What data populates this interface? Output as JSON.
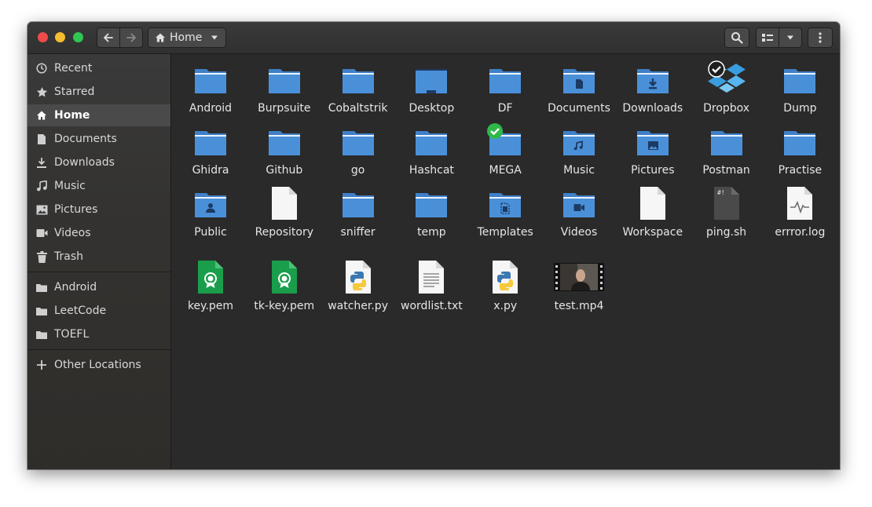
{
  "window": {
    "path_label": "Home"
  },
  "sidebar": {
    "places": [
      {
        "label": "Recent",
        "icon": "clock-icon"
      },
      {
        "label": "Starred",
        "icon": "star-icon"
      },
      {
        "label": "Home",
        "icon": "home-icon",
        "active": true
      },
      {
        "label": "Documents",
        "icon": "document-icon"
      },
      {
        "label": "Downloads",
        "icon": "download-icon"
      },
      {
        "label": "Music",
        "icon": "music-icon"
      },
      {
        "label": "Pictures",
        "icon": "image-icon"
      },
      {
        "label": "Videos",
        "icon": "video-icon"
      },
      {
        "label": "Trash",
        "icon": "trash-icon"
      }
    ],
    "bookmarks": [
      {
        "label": "Android",
        "icon": "folder-icon"
      },
      {
        "label": "LeetCode",
        "icon": "folder-icon"
      },
      {
        "label": "TOEFL",
        "icon": "folder-icon"
      }
    ],
    "other": {
      "label": "Other Locations",
      "icon": "plus-icon"
    }
  },
  "files": [
    {
      "name": "Android",
      "type": "folder"
    },
    {
      "name": "Burpsuite",
      "type": "folder"
    },
    {
      "name": "Cobaltstrik",
      "type": "folder"
    },
    {
      "name": "Desktop",
      "type": "folder-desktop"
    },
    {
      "name": "DF",
      "type": "folder"
    },
    {
      "name": "Documents",
      "type": "folder-documents"
    },
    {
      "name": "Downloads",
      "type": "folder-downloads"
    },
    {
      "name": "Dropbox",
      "type": "dropbox"
    },
    {
      "name": "Dump",
      "type": "folder"
    },
    {
      "name": "Ghidra",
      "type": "folder"
    },
    {
      "name": "Github",
      "type": "folder"
    },
    {
      "name": "go",
      "type": "folder"
    },
    {
      "name": "Hashcat",
      "type": "folder"
    },
    {
      "name": "MEGA",
      "type": "folder-mega"
    },
    {
      "name": "Music",
      "type": "folder-music"
    },
    {
      "name": "Pictures",
      "type": "folder-pictures"
    },
    {
      "name": "Postman",
      "type": "folder"
    },
    {
      "name": "Practise",
      "type": "folder"
    },
    {
      "name": "Public",
      "type": "folder-public"
    },
    {
      "name": "Repository",
      "type": "file-blank"
    },
    {
      "name": "sniffer",
      "type": "folder"
    },
    {
      "name": "temp",
      "type": "folder"
    },
    {
      "name": "Templates",
      "type": "folder-templates"
    },
    {
      "name": "Videos",
      "type": "folder-videos"
    },
    {
      "name": "Workspace",
      "type": "file-blank"
    },
    {
      "name": "ping.sh",
      "type": "file-script"
    },
    {
      "name": "errror.log",
      "type": "file-log"
    },
    {
      "name": "key.pem",
      "type": "file-cert"
    },
    {
      "name": "tk-key.pem",
      "type": "file-cert"
    },
    {
      "name": "watcher.py",
      "type": "file-python"
    },
    {
      "name": "wordlist.txt",
      "type": "file-text"
    },
    {
      "name": "x.py",
      "type": "file-python"
    },
    {
      "name": "test.mp4",
      "type": "file-video"
    }
  ],
  "colors": {
    "folder": "#4a90d9",
    "folder_tab": "#3f80c8",
    "accent_green": "#2fb84a"
  }
}
